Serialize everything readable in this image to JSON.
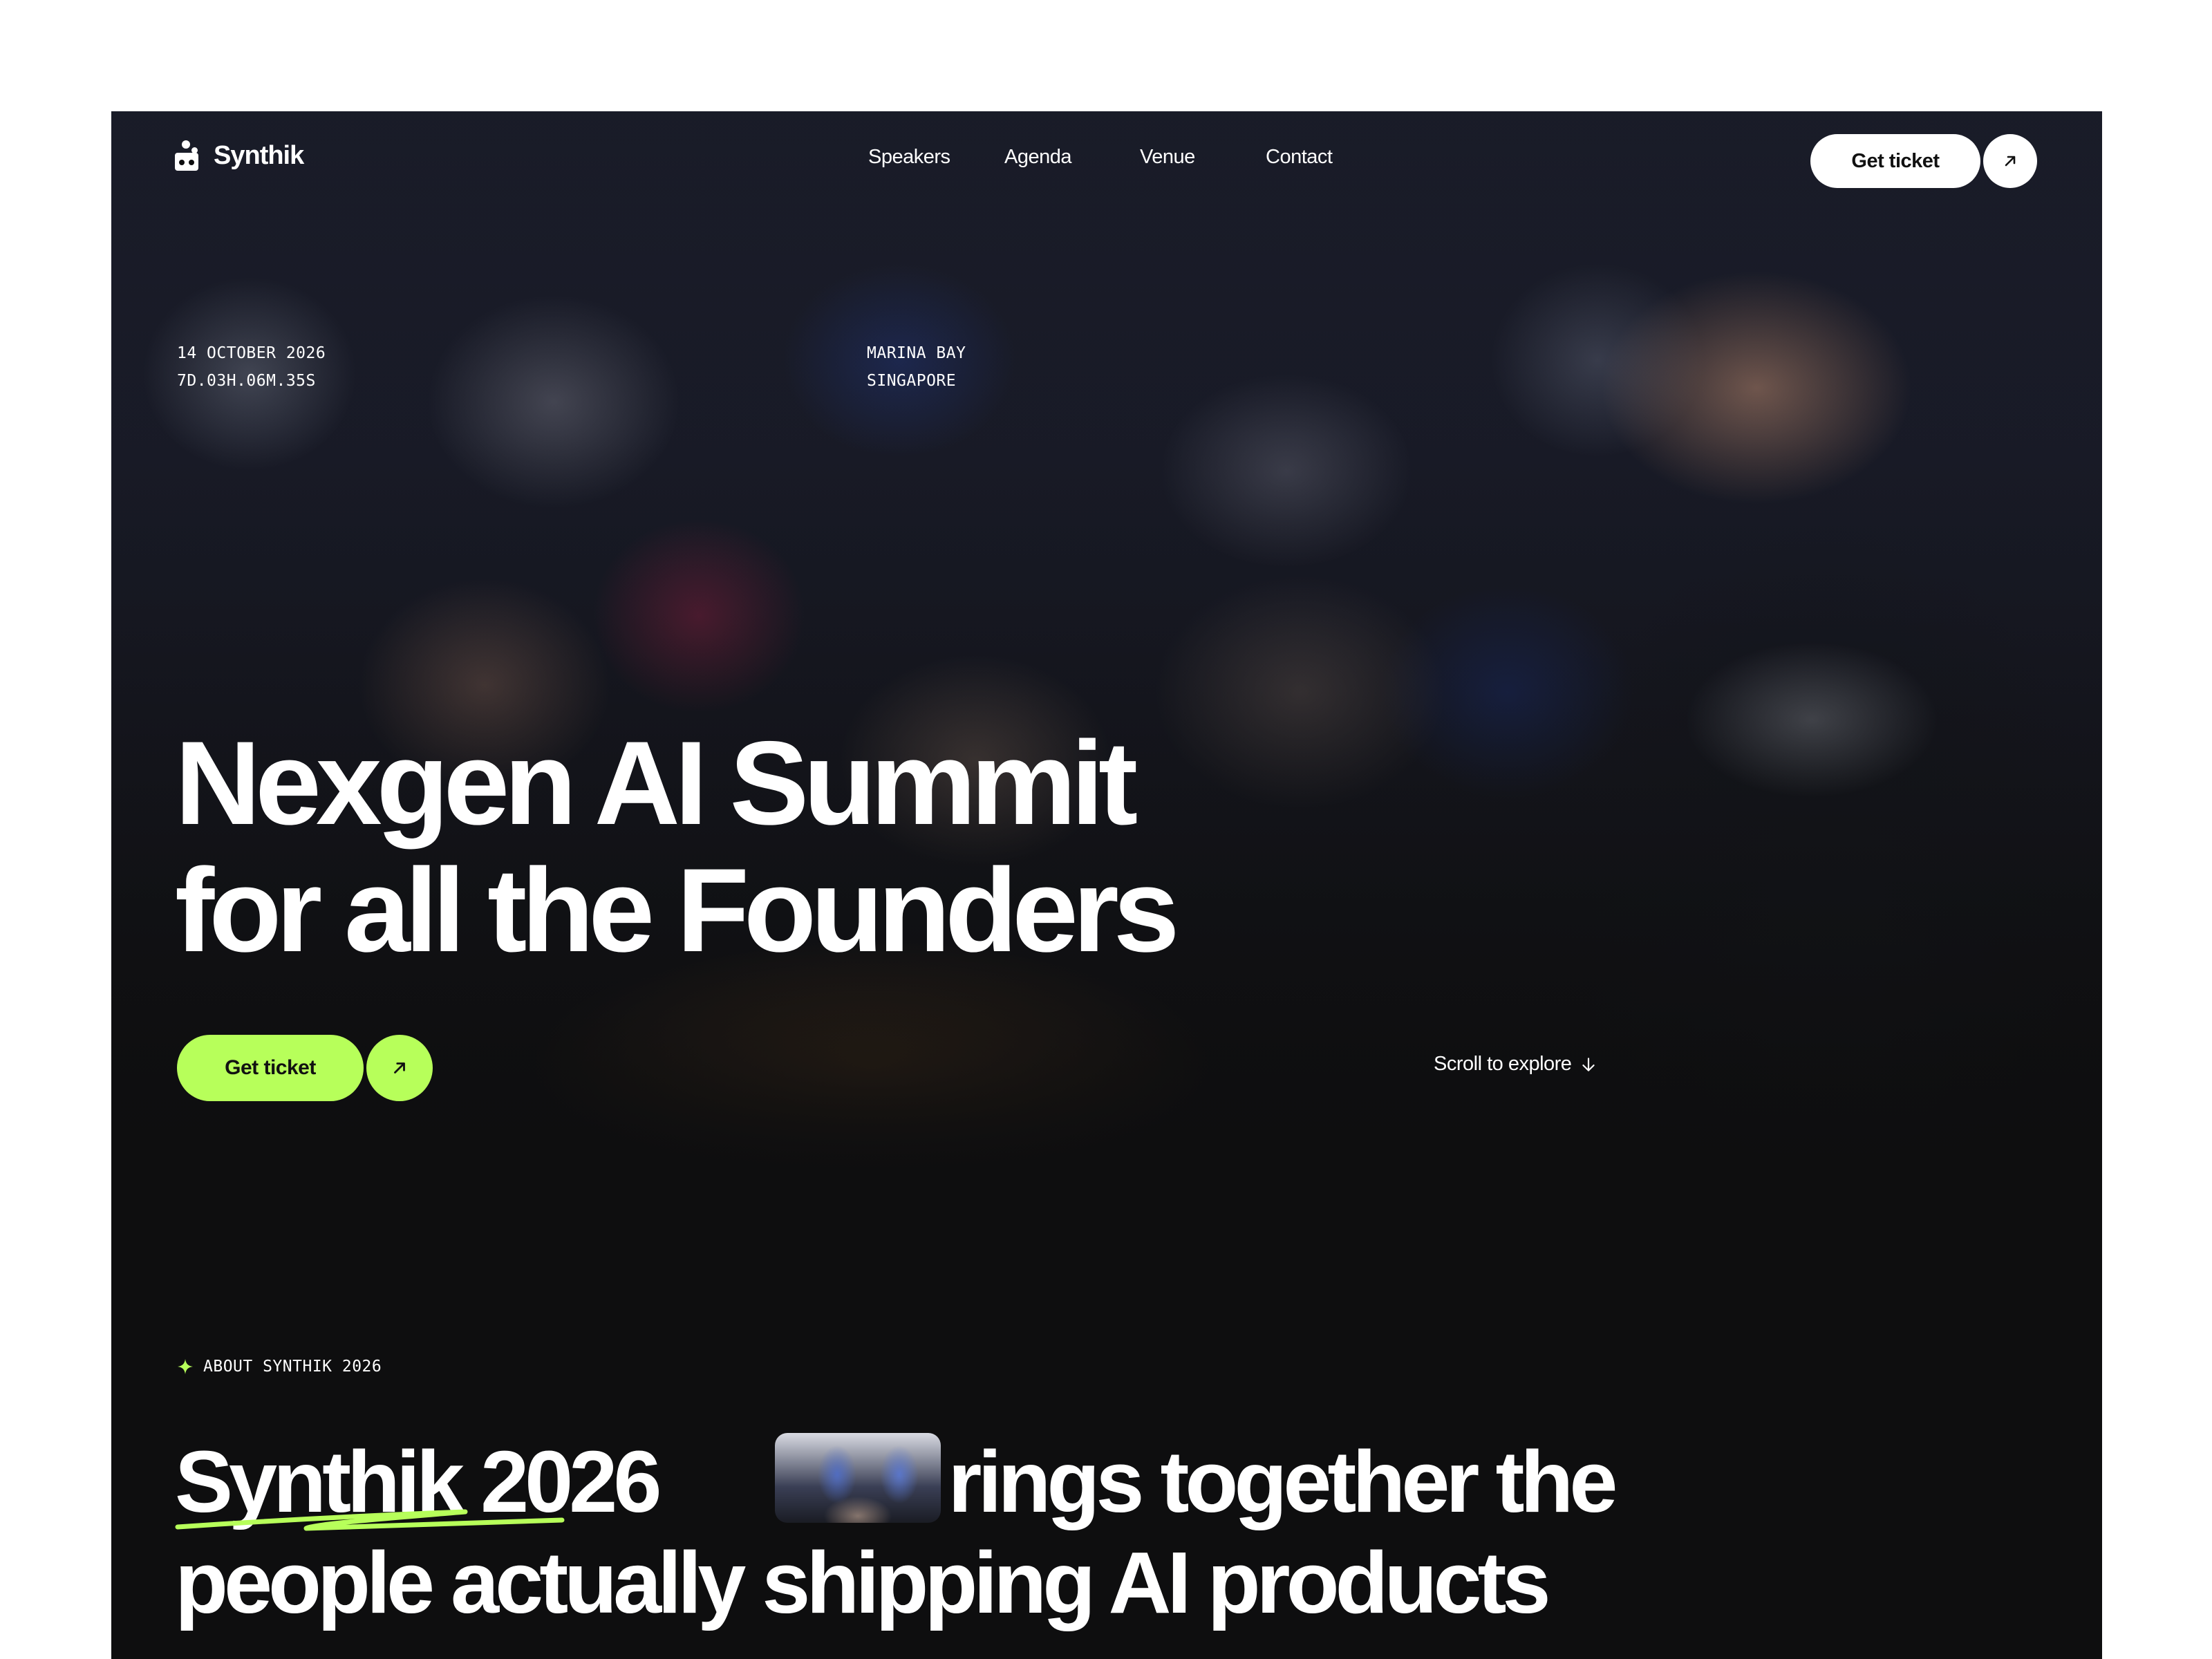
{
  "brand": {
    "name": "Synthik"
  },
  "nav": {
    "items": [
      "Speakers",
      "Agenda",
      "Venue",
      "Contact"
    ]
  },
  "header_cta": {
    "label": "Get ticket"
  },
  "event": {
    "date": "14 OCTOBER 2026",
    "countdown": "7D.03H.06M.35S",
    "location_line1": "MARINA BAY",
    "location_line2": "SINGAPORE"
  },
  "hero": {
    "title_line1": "Nexgen AI Summit",
    "title_line2": "for all the Founders",
    "cta_label": "Get ticket",
    "scroll_label": "Scroll to explore"
  },
  "about": {
    "label": "ABOUT SYNTHIK 2026",
    "highlight": "Synthik 2026",
    "text_line1_rest": "rings together the",
    "text_line2": "people actually shipping AI products"
  },
  "colors": {
    "accent": "#b7ff5a",
    "background": "#0e0e0f",
    "text": "#ffffff"
  },
  "icons": [
    "logo-icon",
    "arrow-up-right-icon",
    "arrow-down-icon",
    "sparkle-icon"
  ]
}
